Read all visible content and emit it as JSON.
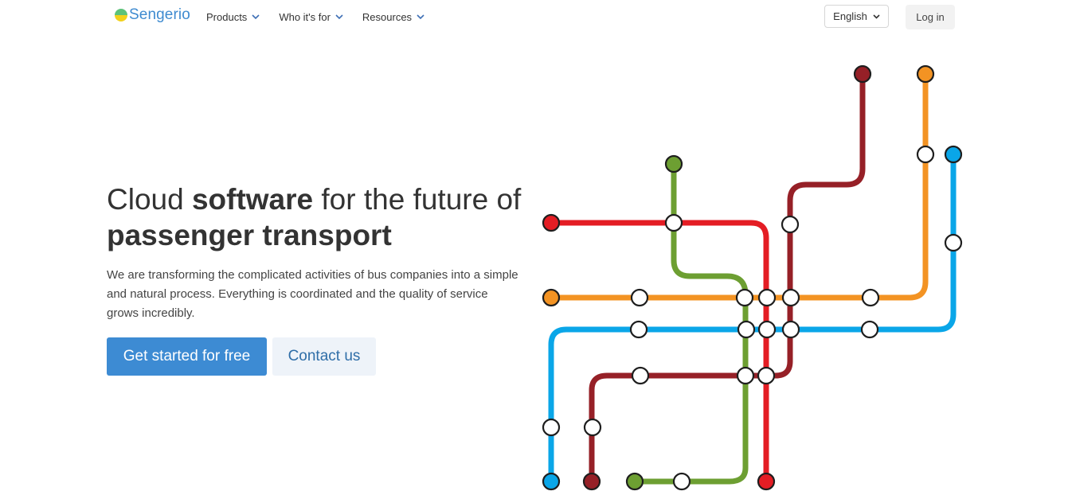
{
  "brand": {
    "name": "Sengerio"
  },
  "nav": {
    "items": [
      {
        "label": "Products"
      },
      {
        "label": "Who it's for"
      },
      {
        "label": "Resources"
      }
    ]
  },
  "header": {
    "language": "English",
    "login_label": "Log in"
  },
  "hero": {
    "title_part1": "Cloud ",
    "title_bold1": "software",
    "title_part2": " for the future of",
    "title_bold2": "passenger transport",
    "description": "We are transforming the complicated activities of bus companies into a simple and natural process. Everything is coordinated and the quality of service grows incredibly.",
    "primary_cta": "Get started for free",
    "secondary_cta": "Contact us"
  },
  "colors": {
    "brand_blue": "#3d8bd3",
    "line_red": "#e41d24",
    "line_orange": "#f39323",
    "line_blue": "#0aa6e8",
    "line_green": "#6d9f32",
    "line_darkred": "#962027"
  }
}
